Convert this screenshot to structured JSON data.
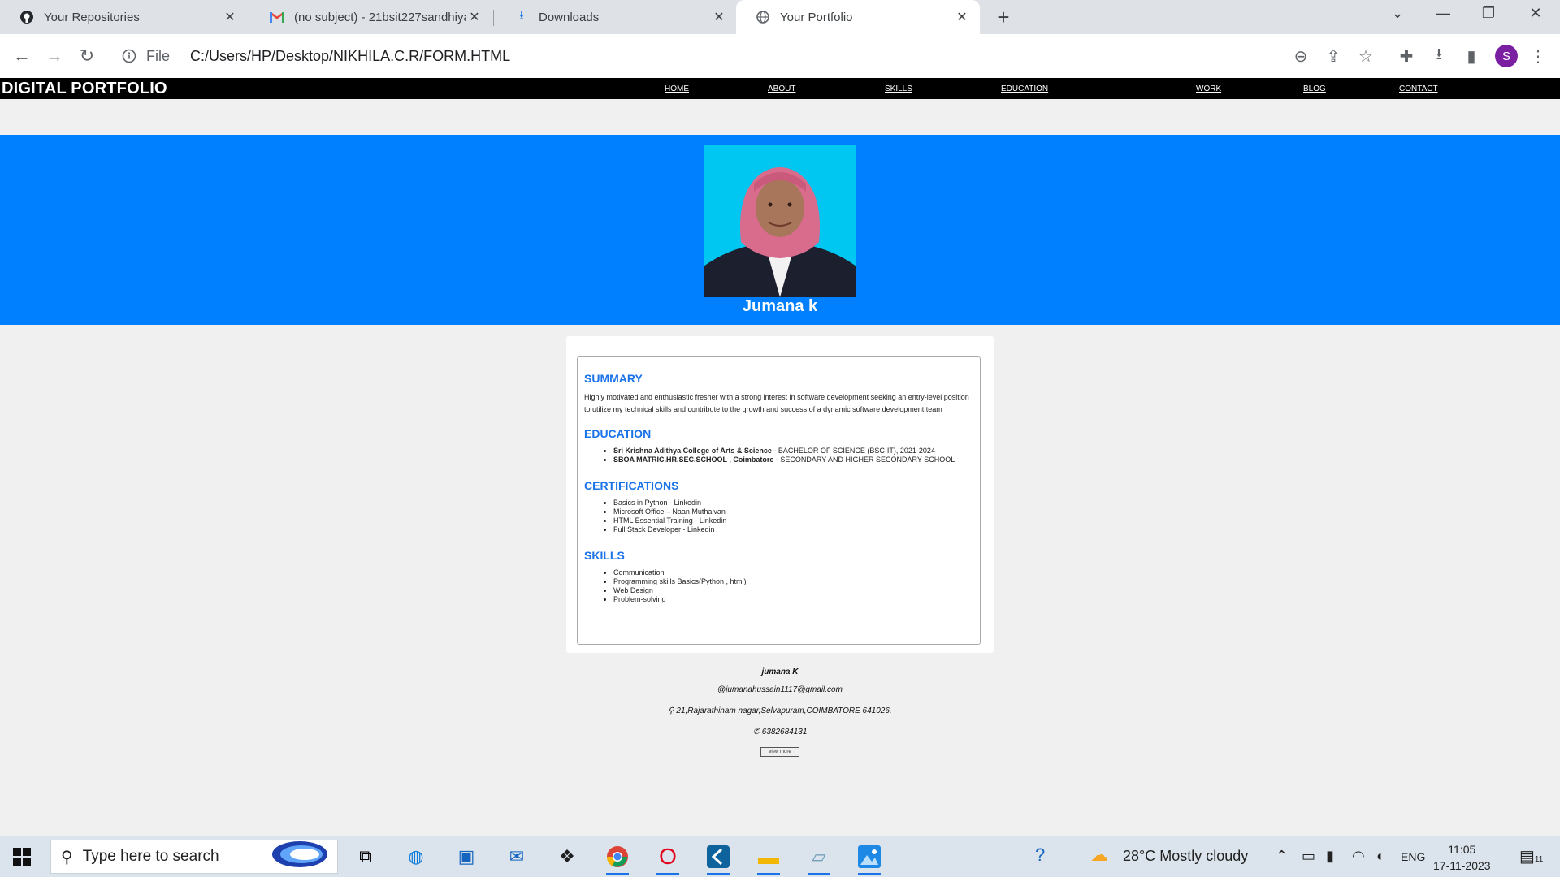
{
  "browser": {
    "tabs": [
      {
        "title": "Your Repositories",
        "icon": "github-icon"
      },
      {
        "title": "(no subject) - 21bsit227sandhiya",
        "icon": "gmail-icon"
      },
      {
        "title": "Downloads",
        "icon": "download-icon"
      },
      {
        "title": "Your Portfolio",
        "icon": "globe-icon",
        "active": true
      }
    ],
    "address": {
      "scheme_label": "File",
      "url": "C:/Users/HP/Desktop/NIKHILA.C.R/FORM.HTML"
    },
    "profile_initial": "S"
  },
  "page": {
    "brand": "DIGITAL PORTFOLIO",
    "nav": [
      "HOME",
      "ABOUT",
      "SKILLS",
      "EDUCATION",
      "WORK",
      "BLOG",
      "CONTACT"
    ],
    "hero": {
      "name": "Jumana k"
    },
    "summary": {
      "heading": "SUMMARY",
      "text": "Highly motivated and enthusiastic fresher with a strong interest in software development seeking an entry-level position to utilize my technical skills and contribute to the growth and success of a dynamic software development team"
    },
    "education": {
      "heading": "EDUCATION",
      "items": [
        {
          "school": "Sri Krishna Adithya College of Arts & Science -",
          "detail": " BACHELOR OF SCIENCE (BSC-IT), 2021-2024"
        },
        {
          "school": "SBOA MATRIC.HR.SEC.SCHOOL , Coimbatore -",
          "detail": " SECONDARY AND HIGHER SECONDARY SCHOOL"
        }
      ]
    },
    "certifications": {
      "heading": "CERTIFICATIONS",
      "items": [
        "Basics in Python - Linkedin",
        "Microsoft Office – Naan Muthalvan",
        "HTML Essential Training - Linkedin",
        "Full Stack Developer - Linkedin"
      ]
    },
    "skills": {
      "heading": "SKILLS",
      "items": [
        "Communication",
        "Programming skills Basics(Python , html)",
        "Web Design",
        "Problem-solving"
      ]
    },
    "footer": {
      "name": "jumana K",
      "email": "@jumanahussain1117@gmail.com",
      "address": "⚲ 21,Rajarathinam nagar,Selvapuram,COIMBATORE 641026.",
      "phone": "✆ 6382684131",
      "button": "view more"
    }
  },
  "taskbar": {
    "search_placeholder": "Type here to search",
    "weather": "28°C  Mostly cloudy",
    "lang": "ENG",
    "time": "11:05",
    "date": "17-11-2023",
    "notification_count": "11"
  },
  "colors": {
    "hero": "#0080ff",
    "accent": "#1a73e8",
    "nav": "#000000"
  }
}
